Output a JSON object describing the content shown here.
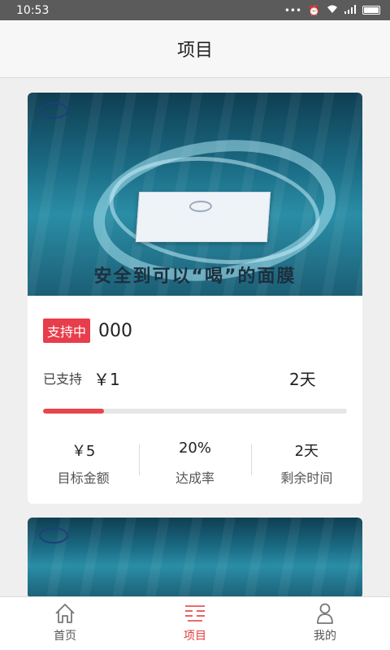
{
  "status_bar": {
    "time": "10:53",
    "icons": [
      "more-dots-icon",
      "alarm-icon",
      "wifi-icon",
      "signal-icon",
      "battery-icon"
    ]
  },
  "nav": {
    "title": "项目"
  },
  "projects": [
    {
      "image_slogan": "安全到可以“喝”的面膜",
      "status": "支持中",
      "name": "000",
      "supported_label": "已支持",
      "supported_amount": "￥1",
      "days_left": "2天",
      "progress_percent": 20,
      "stats": [
        {
          "value": "￥5",
          "label": "目标金额"
        },
        {
          "value": "20%",
          "label": "达成率"
        },
        {
          "value": "2天",
          "label": "剩余时间"
        }
      ]
    }
  ],
  "tabs": [
    {
      "label": "首页",
      "icon": "home-icon",
      "active": false
    },
    {
      "label": "项目",
      "icon": "list-icon",
      "active": true
    },
    {
      "label": "我的",
      "icon": "user-icon",
      "active": false
    }
  ],
  "colors": {
    "accent": "#e23b3b",
    "tag": "#e83d4b",
    "progress": "#e8454c"
  }
}
